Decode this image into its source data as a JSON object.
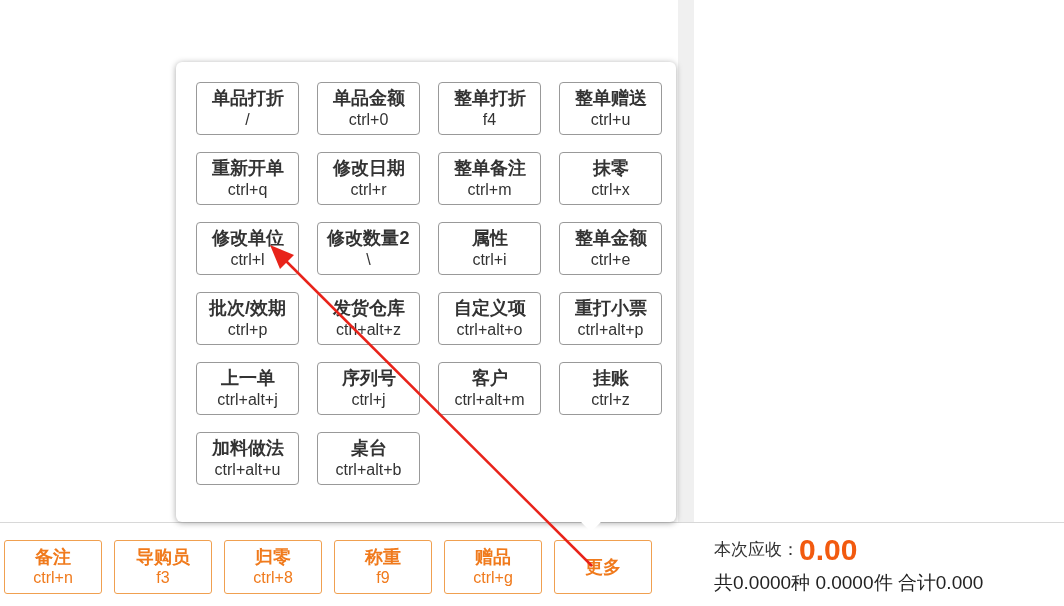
{
  "more_menu": {
    "items": [
      {
        "label": "单品打折",
        "shortcut": "/"
      },
      {
        "label": "单品金额",
        "shortcut": "ctrl+0"
      },
      {
        "label": "整单打折",
        "shortcut": "f4"
      },
      {
        "label": "整单赠送",
        "shortcut": "ctrl+u"
      },
      {
        "label": "重新开单",
        "shortcut": "ctrl+q"
      },
      {
        "label": "修改日期",
        "shortcut": "ctrl+r"
      },
      {
        "label": "整单备注",
        "shortcut": "ctrl+m"
      },
      {
        "label": "抹零",
        "shortcut": "ctrl+x"
      },
      {
        "label": "修改单位",
        "shortcut": "ctrl+l"
      },
      {
        "label": "修改数量2",
        "shortcut": "\\"
      },
      {
        "label": "属性",
        "shortcut": "ctrl+i"
      },
      {
        "label": "整单金额",
        "shortcut": "ctrl+e"
      },
      {
        "label": "批次/效期",
        "shortcut": "ctrl+p"
      },
      {
        "label": "发货仓库",
        "shortcut": "ctrl+alt+z"
      },
      {
        "label": "自定义项",
        "shortcut": "ctrl+alt+o"
      },
      {
        "label": "重打小票",
        "shortcut": "ctrl+alt+p"
      },
      {
        "label": "上一单",
        "shortcut": "ctrl+alt+j"
      },
      {
        "label": "序列号",
        "shortcut": "ctrl+j"
      },
      {
        "label": "客户",
        "shortcut": "ctrl+alt+m"
      },
      {
        "label": "挂账",
        "shortcut": "ctrl+z"
      },
      {
        "label": "加料做法",
        "shortcut": "ctrl+alt+u"
      },
      {
        "label": "桌台",
        "shortcut": "ctrl+alt+b"
      }
    ]
  },
  "toolbar": [
    {
      "label": "备注",
      "shortcut": "ctrl+n"
    },
    {
      "label": "导购员",
      "shortcut": "f3"
    },
    {
      "label": "归零",
      "shortcut": "ctrl+8"
    },
    {
      "label": "称重",
      "shortcut": "f9"
    },
    {
      "label": "赠品",
      "shortcut": "ctrl+g"
    },
    {
      "label": "更多"
    }
  ],
  "summary": {
    "due_label": "本次应收：",
    "due_amount": "0.00",
    "totals": "共0.0000种 0.0000件 合计0.000"
  }
}
